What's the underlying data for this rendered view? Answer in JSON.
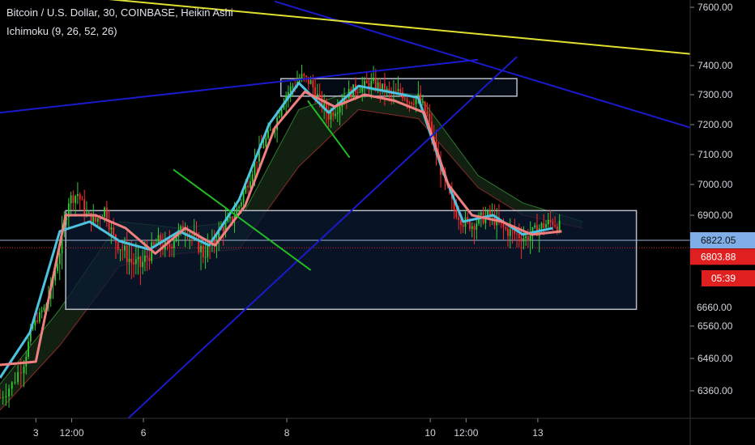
{
  "header": {
    "title": "Bitcoin / U.S. Dollar, 30, COINBASE, Heikin Ashi",
    "indicator": "Ichimoku (9, 26, 52, 26)"
  },
  "colors": {
    "background": "#000000",
    "bull": "#33cc33",
    "bear": "#ff2a2a",
    "conversion": "#4dc3e0",
    "base": "#f08080",
    "trend_blue": "#1a1acc",
    "trend_yellow": "#e0e030",
    "trend_green": "#22bb22",
    "box": "#b8bcc8",
    "last_price": "#e02020",
    "crosshair_price": "#7faee8"
  },
  "chart_data": {
    "type": "candlestick",
    "y_ticks": [
      "7600.00",
      "7400.00",
      "7300.00",
      "7200.00",
      "7100.00",
      "7000.00",
      "6900.00",
      "6822.05",
      "6803.88",
      "05:39",
      "6560.00",
      "6460.00",
      "6360.00"
    ],
    "y_tick_values": [
      7600,
      7400,
      7300,
      7200,
      7100,
      7000,
      6900,
      6822.05,
      6803.88,
      6660,
      6560,
      6460,
      6360
    ],
    "x_ticks": [
      "3",
      "12:00",
      "6",
      "8",
      "10",
      "12:00",
      "13"
    ],
    "x_tick_hours": [
      12,
      24,
      48,
      96,
      144,
      156,
      180
    ],
    "ylim": [
      6300,
      7620
    ],
    "xlim_hours": [
      0,
      231
    ],
    "grid": false,
    "crosshair_price": 6822.05,
    "last_price": 6803.88,
    "countdown": "05:39",
    "series": [
      {
        "name": "Bitcoin / U.S. Dollar",
        "style": "heikin-ashi",
        "close_path": [
          [
            0,
            6340
          ],
          [
            4,
            6380
          ],
          [
            8,
            6450
          ],
          [
            11,
            6560
          ],
          [
            14,
            6640
          ],
          [
            17,
            6700
          ],
          [
            20,
            6800
          ],
          [
            23,
            6950
          ],
          [
            26,
            6970
          ],
          [
            29,
            6900
          ],
          [
            32,
            6880
          ],
          [
            35,
            6920
          ],
          [
            38,
            6830
          ],
          [
            41,
            6800
          ],
          [
            44,
            6770
          ],
          [
            47,
            6760
          ],
          [
            50,
            6790
          ],
          [
            53,
            6820
          ],
          [
            56,
            6800
          ],
          [
            59,
            6840
          ],
          [
            62,
            6860
          ],
          [
            65,
            6830
          ],
          [
            68,
            6790
          ],
          [
            71,
            6810
          ],
          [
            74,
            6860
          ],
          [
            77,
            6880
          ],
          [
            80,
            6930
          ],
          [
            83,
            7010
          ],
          [
            86,
            7090
          ],
          [
            89,
            7150
          ],
          [
            92,
            7200
          ],
          [
            95,
            7290
          ],
          [
            98,
            7330
          ],
          [
            101,
            7360
          ],
          [
            104,
            7340
          ],
          [
            107,
            7280
          ],
          [
            110,
            7230
          ],
          [
            113,
            7260
          ],
          [
            116,
            7300
          ],
          [
            119,
            7320
          ],
          [
            122,
            7330
          ],
          [
            125,
            7340
          ],
          [
            128,
            7320
          ],
          [
            131,
            7300
          ],
          [
            134,
            7310
          ],
          [
            137,
            7280
          ],
          [
            140,
            7290
          ],
          [
            143,
            7230
          ],
          [
            146,
            7100
          ],
          [
            149,
            7000
          ],
          [
            152,
            6920
          ],
          [
            155,
            6880
          ],
          [
            158,
            6870
          ],
          [
            161,
            6890
          ],
          [
            164,
            6900
          ],
          [
            167,
            6870
          ],
          [
            170,
            6850
          ],
          [
            173,
            6840
          ],
          [
            176,
            6830
          ],
          [
            179,
            6850
          ],
          [
            182,
            6870
          ],
          [
            185,
            6880
          ],
          [
            188,
            6860
          ]
        ]
      },
      {
        "name": "Conversion",
        "style": "line",
        "path": [
          [
            0,
            6400
          ],
          [
            10,
            6540
          ],
          [
            20,
            6850
          ],
          [
            30,
            6880
          ],
          [
            40,
            6820
          ],
          [
            50,
            6800
          ],
          [
            60,
            6850
          ],
          [
            70,
            6810
          ],
          [
            80,
            6950
          ],
          [
            90,
            7200
          ],
          [
            100,
            7340
          ],
          [
            110,
            7240
          ],
          [
            120,
            7330
          ],
          [
            130,
            7310
          ],
          [
            140,
            7290
          ],
          [
            148,
            7050
          ],
          [
            155,
            6880
          ],
          [
            165,
            6900
          ],
          [
            175,
            6840
          ],
          [
            185,
            6860
          ]
        ]
      },
      {
        "name": "Base",
        "style": "line",
        "path": [
          [
            0,
            6440
          ],
          [
            12,
            6450
          ],
          [
            22,
            6900
          ],
          [
            32,
            6900
          ],
          [
            42,
            6860
          ],
          [
            52,
            6790
          ],
          [
            62,
            6860
          ],
          [
            72,
            6810
          ],
          [
            82,
            6930
          ],
          [
            92,
            7190
          ],
          [
            102,
            7310
          ],
          [
            112,
            7260
          ],
          [
            122,
            7300
          ],
          [
            132,
            7280
          ],
          [
            142,
            7240
          ],
          [
            150,
            7000
          ],
          [
            158,
            6900
          ],
          [
            168,
            6880
          ],
          [
            178,
            6840
          ],
          [
            188,
            6850
          ]
        ]
      },
      {
        "name": "Cloud",
        "style": "cloud",
        "upper": [
          [
            0,
            6380
          ],
          [
            20,
            6650
          ],
          [
            40,
            6880
          ],
          [
            60,
            6860
          ],
          [
            80,
            6880
          ],
          [
            100,
            7250
          ],
          [
            120,
            7320
          ],
          [
            140,
            7300
          ],
          [
            160,
            7030
          ],
          [
            175,
            6940
          ],
          [
            195,
            6880
          ]
        ],
        "lower": [
          [
            0,
            6300
          ],
          [
            20,
            6500
          ],
          [
            40,
            6760
          ],
          [
            60,
            6790
          ],
          [
            80,
            6800
          ],
          [
            100,
            7060
          ],
          [
            120,
            7250
          ],
          [
            140,
            7220
          ],
          [
            160,
            6990
          ],
          [
            175,
            6900
          ],
          [
            195,
            6860
          ]
        ]
      }
    ],
    "drawings": [
      {
        "kind": "trendline",
        "color": "blue",
        "from": [
          0,
          7240
        ],
        "to": [
          160,
          7420
        ]
      },
      {
        "kind": "trendline",
        "color": "blue",
        "from": [
          40,
          6250
        ],
        "to": [
          173,
          7430
        ]
      },
      {
        "kind": "trendline",
        "color": "blue",
        "from": [
          92,
          7620
        ],
        "to": [
          231,
          7190
        ]
      },
      {
        "kind": "trendline",
        "color": "yellow",
        "from": [
          34,
          7630
        ],
        "to": [
          231,
          7440
        ]
      },
      {
        "kind": "trendline",
        "color": "green",
        "from": [
          58,
          7050
        ],
        "to": [
          104,
          6750
        ]
      },
      {
        "kind": "trendline",
        "color": "green",
        "from": [
          103,
          7280
        ],
        "to": [
          117,
          7090
        ]
      },
      {
        "kind": "rectangle",
        "from": [
          22,
          6915
        ],
        "to": [
          213,
          6650
        ]
      },
      {
        "kind": "rectangle",
        "from": [
          94,
          7355
        ],
        "to": [
          173,
          7295
        ]
      }
    ]
  }
}
